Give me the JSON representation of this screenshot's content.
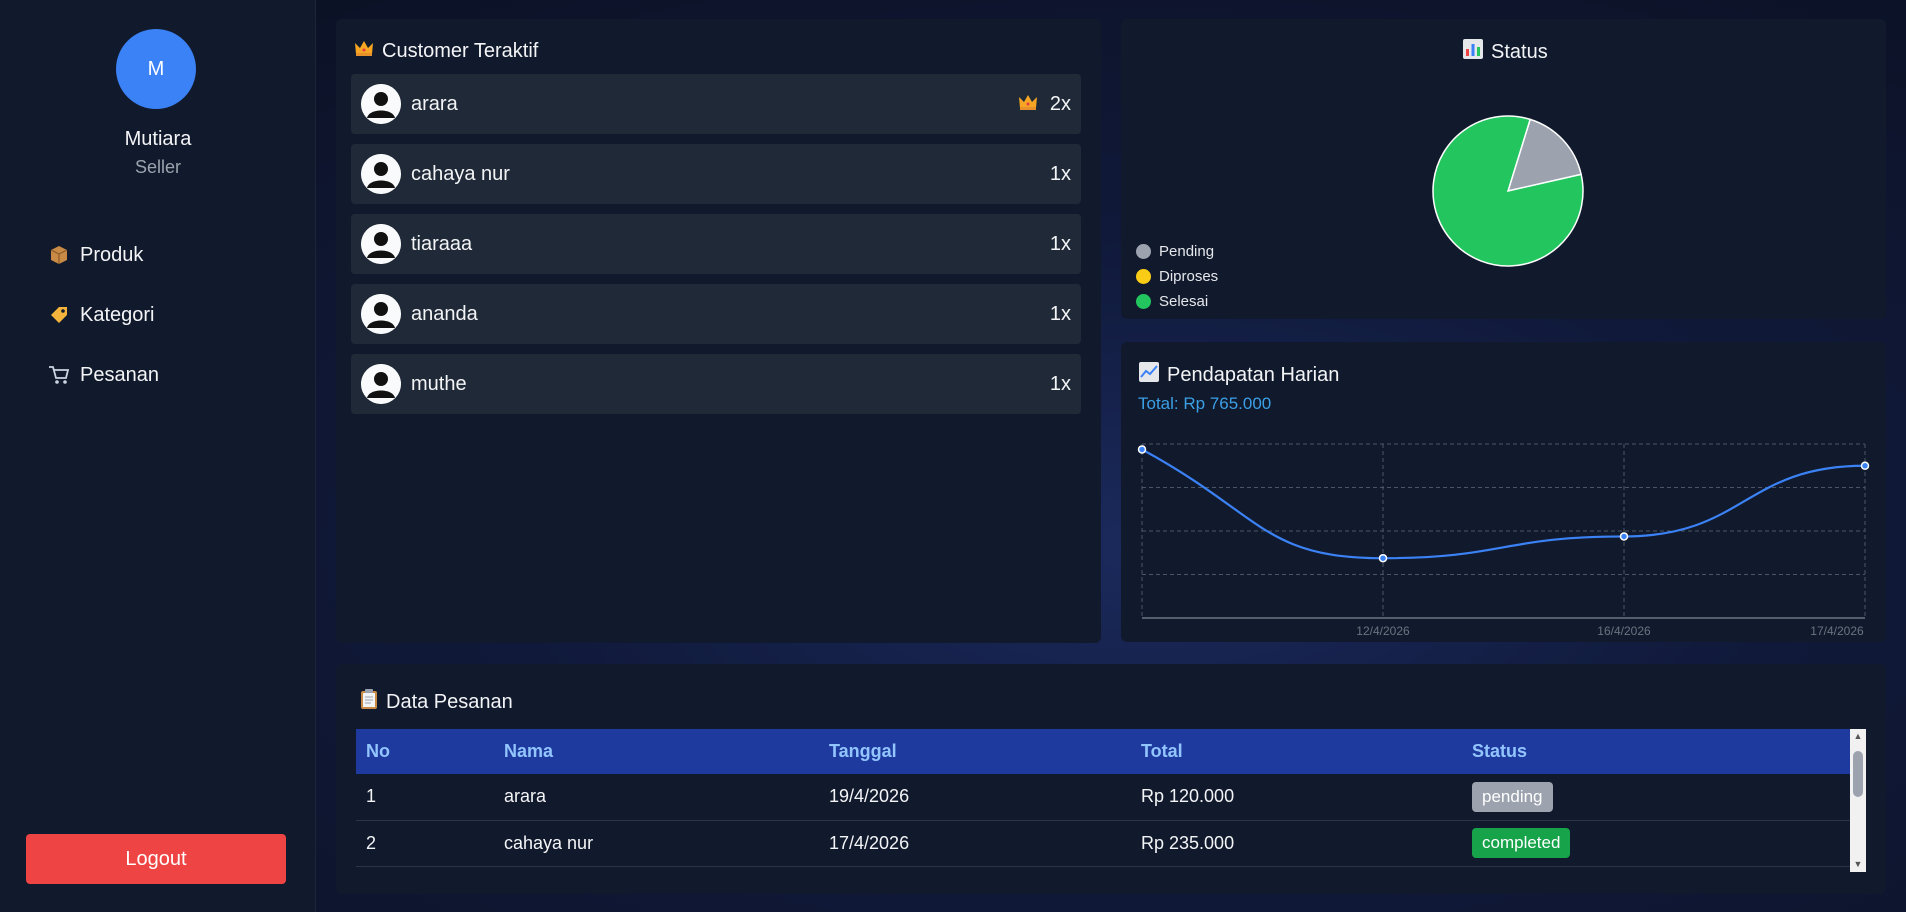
{
  "sidebar": {
    "avatar_initial": "M",
    "user_name": "Mutiara",
    "user_role": "Seller",
    "menu": [
      {
        "label": "Produk",
        "icon": "package-icon"
      },
      {
        "label": "Kategori",
        "icon": "tag-icon"
      },
      {
        "label": "Pesanan",
        "icon": "cart-icon"
      }
    ],
    "logout_label": "Logout"
  },
  "customers": {
    "title": "Customer Teraktif",
    "items": [
      {
        "name": "arara",
        "count": "2x",
        "top": true
      },
      {
        "name": "cahaya nur",
        "count": "1x",
        "top": false
      },
      {
        "name": "tiaraaa",
        "count": "1x",
        "top": false
      },
      {
        "name": "ananda",
        "count": "1x",
        "top": false
      },
      {
        "name": "muthe",
        "count": "1x",
        "top": false
      }
    ]
  },
  "status": {
    "title": "Status",
    "legend": [
      {
        "label": "Pending",
        "color": "#9ca3af"
      },
      {
        "label": "Diproses",
        "color": "#facc15"
      },
      {
        "label": "Selesai",
        "color": "#22c55e"
      }
    ]
  },
  "revenue": {
    "title": "Pendapatan Harian",
    "total": "Total: Rp 765.000"
  },
  "chart_data": [
    {
      "type": "pie",
      "categories": [
        "Pending",
        "Diproses",
        "Selesai"
      ],
      "values": [
        1,
        0,
        5
      ],
      "colors": [
        "#9ca3af",
        "#facc15",
        "#22c55e"
      ],
      "legend": "left-bottom"
    },
    {
      "type": "line",
      "x": [
        "",
        "12/4/2026",
        "16/4/2026",
        "17/4/2026"
      ],
      "values": [
        255000,
        155000,
        175000,
        240000
      ],
      "ylim": [
        100000,
        260000
      ],
      "grid": true,
      "color": "#3b82f6"
    }
  ],
  "orders": {
    "title": "Data Pesanan",
    "columns": [
      "No",
      "Nama",
      "Tanggal",
      "Total",
      "Status"
    ],
    "rows": [
      {
        "no": "1",
        "nama": "arara",
        "tanggal": "19/4/2026",
        "total": "Rp 120.000",
        "status": "pending",
        "status_color": "#9ca3af"
      },
      {
        "no": "2",
        "nama": "cahaya nur",
        "tanggal": "17/4/2026",
        "total": "Rp 235.000",
        "status": "completed",
        "status_color": "#16a34a"
      }
    ]
  }
}
